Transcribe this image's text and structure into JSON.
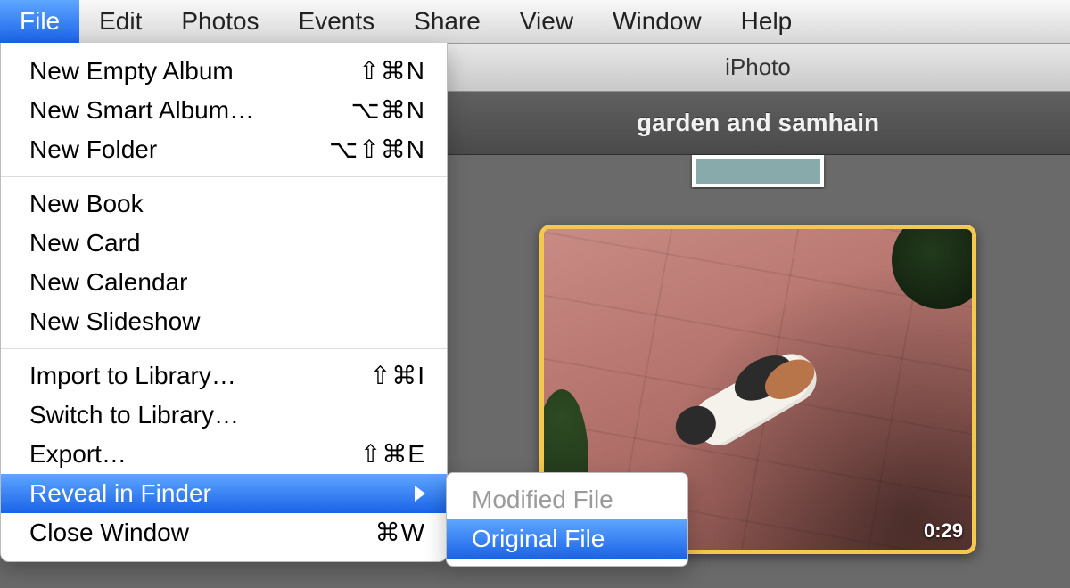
{
  "menubar": {
    "items": [
      {
        "label": "File",
        "active": true
      },
      {
        "label": "Edit"
      },
      {
        "label": "Photos"
      },
      {
        "label": "Events"
      },
      {
        "label": "Share"
      },
      {
        "label": "View"
      },
      {
        "label": "Window"
      },
      {
        "label": "Help"
      }
    ]
  },
  "file_menu": {
    "new_empty_album": {
      "label": "New Empty Album",
      "shortcut": "⇧⌘N"
    },
    "new_smart_album": {
      "label": "New Smart Album…",
      "shortcut": "⌥⌘N"
    },
    "new_folder": {
      "label": "New Folder",
      "shortcut": "⌥⇧⌘N"
    },
    "new_book": {
      "label": "New Book"
    },
    "new_card": {
      "label": "New Card"
    },
    "new_calendar": {
      "label": "New Calendar"
    },
    "new_slideshow": {
      "label": "New Slideshow"
    },
    "import_library": {
      "label": "Import to Library…",
      "shortcut": "⇧⌘I"
    },
    "switch_library": {
      "label": "Switch to Library…"
    },
    "export": {
      "label": "Export…",
      "shortcut": "⇧⌘E"
    },
    "reveal_finder": {
      "label": "Reveal in Finder"
    },
    "close_window": {
      "label": "Close Window",
      "shortcut": "⌘W"
    }
  },
  "reveal_submenu": {
    "modified": {
      "label": "Modified File",
      "enabled": false
    },
    "original": {
      "label": "Original File",
      "enabled": true,
      "highlighted": true
    }
  },
  "window": {
    "app_title": "iPhoto",
    "event_title": "garden and samhain",
    "clip_duration": "0:29"
  }
}
